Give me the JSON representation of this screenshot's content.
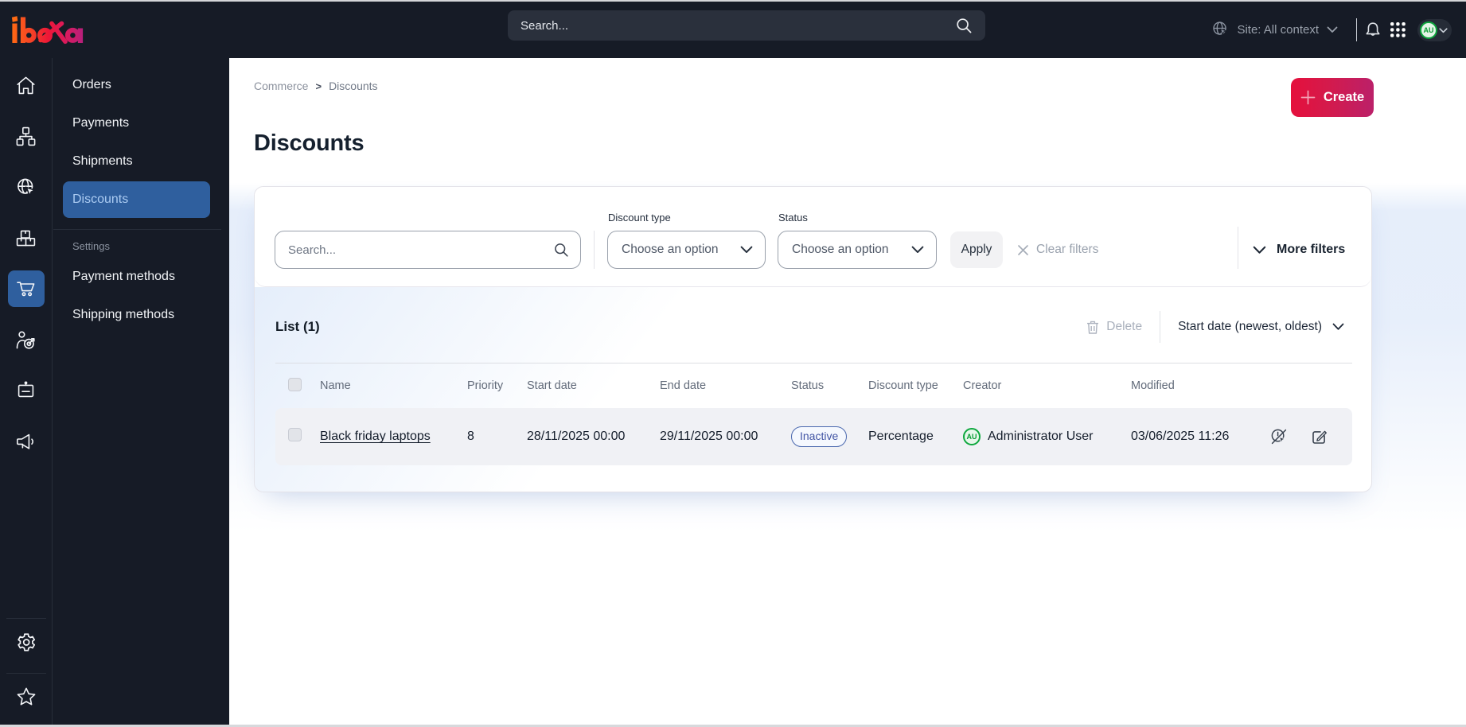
{
  "topbar": {
    "logo_text": "ibexa",
    "search_placeholder": "Search...",
    "site_context_label": "Site: All context",
    "user_initials": "AU"
  },
  "sidebar": {
    "rail_items": [
      {
        "icon": "home-icon",
        "active": false
      },
      {
        "icon": "content-tree-icon",
        "active": false
      },
      {
        "icon": "site-globe-icon",
        "active": false
      },
      {
        "icon": "storage-boxes-icon",
        "active": false
      },
      {
        "icon": "commerce-cart-icon",
        "active": true
      },
      {
        "icon": "personalization-target-icon",
        "active": false
      },
      {
        "icon": "vendor-badge-icon",
        "active": false
      },
      {
        "icon": "marketing-megaphone-icon",
        "active": false
      }
    ],
    "rail_bottom_items": [
      {
        "icon": "settings-gear-icon"
      },
      {
        "icon": "bookmark-star-icon"
      }
    ],
    "menu_items": [
      {
        "label": "Orders",
        "active": false
      },
      {
        "label": "Payments",
        "active": false
      },
      {
        "label": "Shipments",
        "active": false
      },
      {
        "label": "Discounts",
        "active": true
      }
    ],
    "section_label": "Settings",
    "settings_items": [
      {
        "label": "Payment methods"
      },
      {
        "label": "Shipping methods"
      }
    ]
  },
  "breadcrumb": {
    "items": [
      "Commerce",
      "Discounts"
    ],
    "separator": ">"
  },
  "page": {
    "title": "Discounts",
    "create_label": "Create"
  },
  "filters": {
    "search_placeholder": "Search...",
    "discount_type_label": "Discount type",
    "discount_type_value": "Choose an option",
    "status_label": "Status",
    "status_value": "Choose an option",
    "apply_label": "Apply",
    "clear_label": "Clear filters",
    "more_label": "More filters"
  },
  "list": {
    "title": "List (1)",
    "delete_label": "Delete",
    "sort_label": "Start date (newest, oldest)",
    "columns": [
      "Name",
      "Priority",
      "Start date",
      "End date",
      "Status",
      "Discount type",
      "Creator",
      "Modified"
    ],
    "rows": [
      {
        "name": "Black friday laptops",
        "priority": "8",
        "start_date": "28/11/2025 00:00",
        "end_date": "29/11/2025 00:00",
        "status": "Inactive",
        "discount_type": "Percentage",
        "creator_initials": "AU",
        "creator": "Administrator User",
        "modified": "03/06/2025 11:26"
      }
    ]
  },
  "colors": {
    "topbar_bg": "#161b26",
    "active_blue": "#2f5f9e",
    "create_gradient_start": "#e5103c",
    "create_gradient_end": "#bb2069",
    "badge_blue": "#4a68ae",
    "avatar_green": "#0ca33b",
    "band_blue": "#e3ecfa"
  }
}
